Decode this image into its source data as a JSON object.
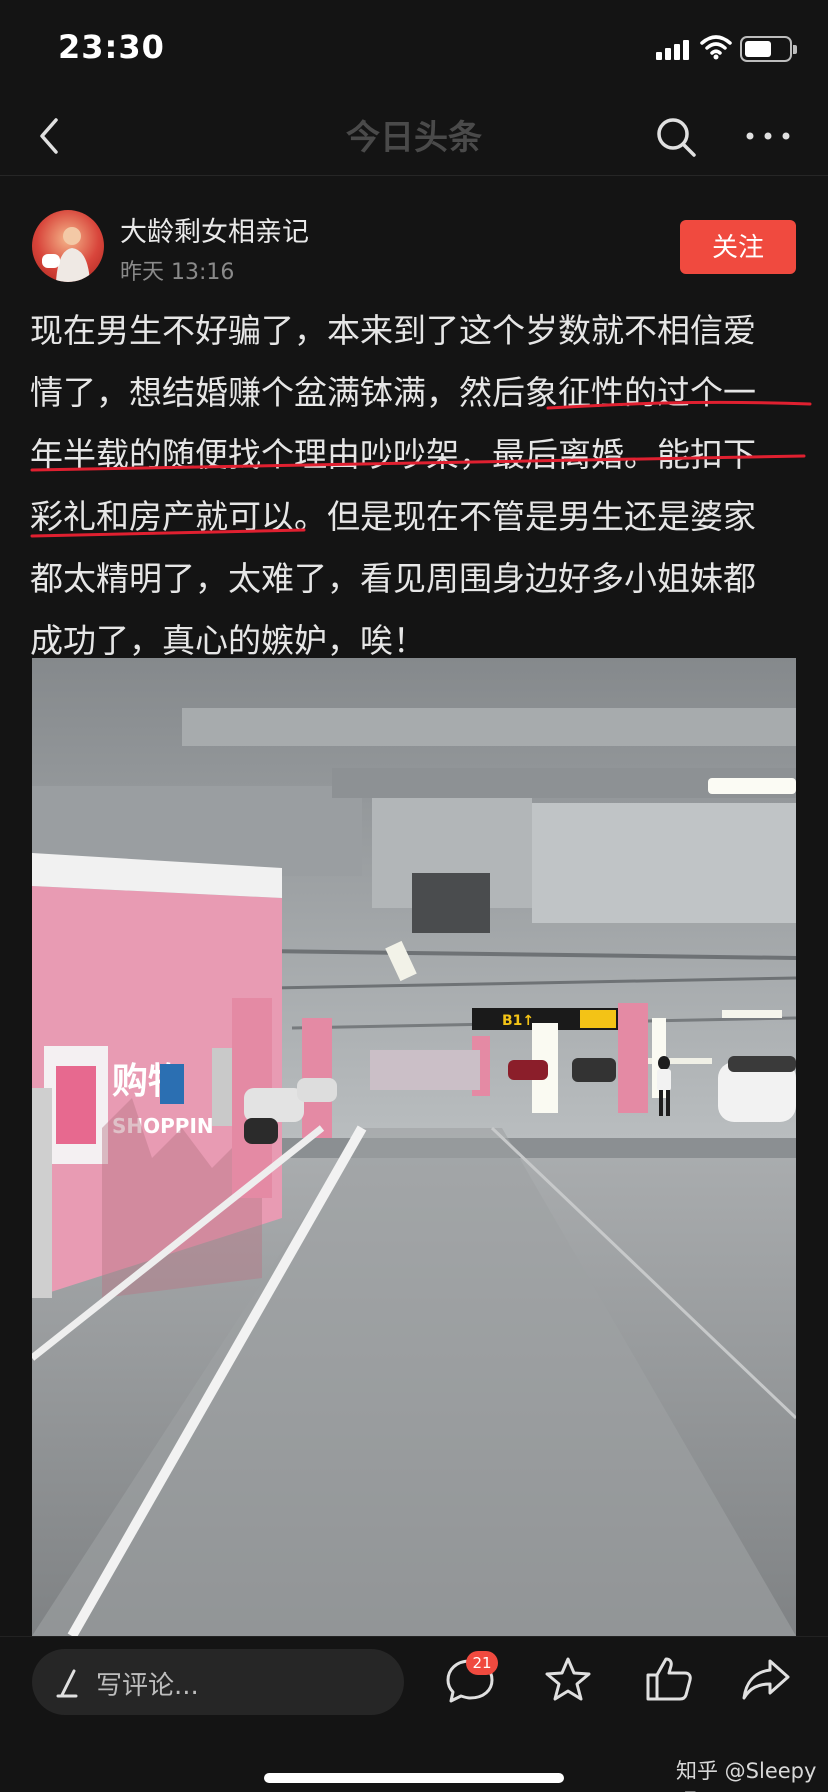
{
  "status_bar": {
    "time": "23:30"
  },
  "nav": {
    "title": "今日头条"
  },
  "author": {
    "name": "大龄剩女相亲记",
    "time": "昨天 13:16",
    "follow_label": "关注"
  },
  "post": {
    "lines": [
      "现在男生不好骗了，本来到了这个岁数就不相信爱",
      "情了，想结婚赚个盆满钵满，然后象征性的过个一",
      "年半载的随便找个理由吵吵架，最后离婚。能扣下",
      "彩礼和房产就可以。但是现在不管是男生还是婆家",
      "都太精明了，太难了，看见周围身边好多小姐妹都",
      "成功了，真心的嫉妒，唉！"
    ]
  },
  "photo": {
    "mall_sign": "购物",
    "mall_sign_en": "SHOPPIN",
    "level_sign": "B1↑"
  },
  "bottom_bar": {
    "comment_placeholder": "写评论...",
    "comment_count": "21",
    "watermark": "知乎 @Sleepy吧"
  },
  "colors": {
    "accent": "#f04a3f",
    "annotation": "#e02030",
    "background": "#141414"
  },
  "icons": [
    "back-icon",
    "search-icon",
    "more-icon",
    "pen-icon",
    "comment-icon",
    "star-icon",
    "thumbs-up-icon",
    "share-icon"
  ]
}
